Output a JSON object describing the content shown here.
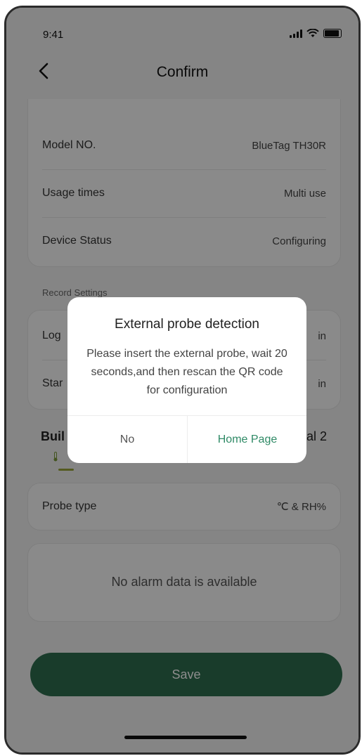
{
  "status_bar": {
    "time": "9:41",
    "icons": [
      "signal-icon",
      "wifi-icon",
      "battery-icon"
    ]
  },
  "header": {
    "title": "Confirm",
    "back_icon": "chevron-left-icon"
  },
  "device_info": {
    "rows": [
      {
        "label": "Model NO.",
        "value": "BlueTag TH30R"
      },
      {
        "label": "Usage times",
        "value": "Multi use"
      },
      {
        "label": "Device Status",
        "value": "Configuring"
      }
    ]
  },
  "record_settings": {
    "section_label": "Record Settings",
    "rows": [
      {
        "label_fragment": "Log",
        "value_fragment": "in"
      },
      {
        "label_fragment": "Star",
        "value_fragment": "in"
      }
    ]
  },
  "probe_tabs": {
    "left_fragment": "Buil",
    "right_fragment": "al 2",
    "tab_icon": "thermometer-icon"
  },
  "probe_card": {
    "label": "Probe type",
    "value": "℃ & RH%"
  },
  "alarm_card": {
    "empty_text": "No alarm data is available"
  },
  "footer": {
    "save_label": "Save"
  },
  "dialog": {
    "title": "External probe detection",
    "message": "Please insert the external probe, wait 20 seconds,and then rescan the QR code for configuration",
    "no_label": "No",
    "home_label": "Home Page"
  },
  "colors": {
    "accent": "#2f6e4f",
    "link": "#2f8a66",
    "tab_indicator": "#9aa43a"
  }
}
